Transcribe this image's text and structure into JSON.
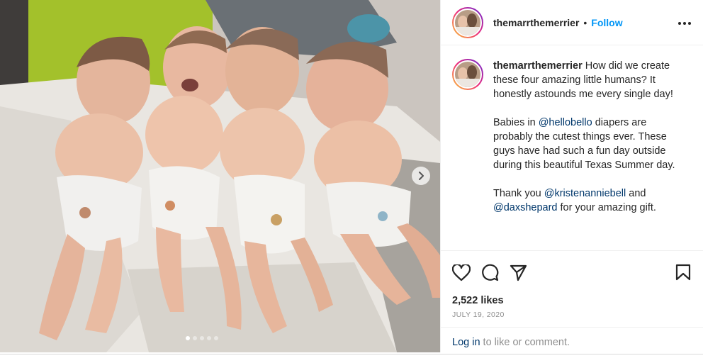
{
  "post": {
    "author": "themarrthemerrier",
    "separator": "•",
    "follow_label": "Follow",
    "more_icon": "more-horizontal-icon"
  },
  "caption": {
    "username": "themarrthemerrier",
    "paragraph1": "How did we create these four amazing little humans? It honestly astounds me every single day!",
    "p2_before": "Babies in ",
    "p2_mention": "@hellobello",
    "p2_after": " diapers are probably the cutest things ever. These guys have had such a fun day outside during this beautiful Texas Summer day.",
    "p3_before": "Thank you ",
    "p3_mention1": "@kristenanniebell",
    "p3_middle": " and ",
    "p3_mention2": "@daxshepard",
    "p3_after": " for your amazing gift."
  },
  "actions": {
    "like_icon": "heart-icon",
    "comment_icon": "comment-icon",
    "share_icon": "send-icon",
    "save_icon": "bookmark-icon",
    "likes": "2,522 likes",
    "date": "JULY 19, 2020"
  },
  "login": {
    "link": "Log in",
    "rest": " to like or comment."
  },
  "carousel": {
    "current_slide": 1,
    "total_slides": 5,
    "next_icon": "chevron-right-icon"
  },
  "colors": {
    "accent": "#0095f6",
    "mention": "#00376b",
    "muted": "#8e8e8e"
  }
}
